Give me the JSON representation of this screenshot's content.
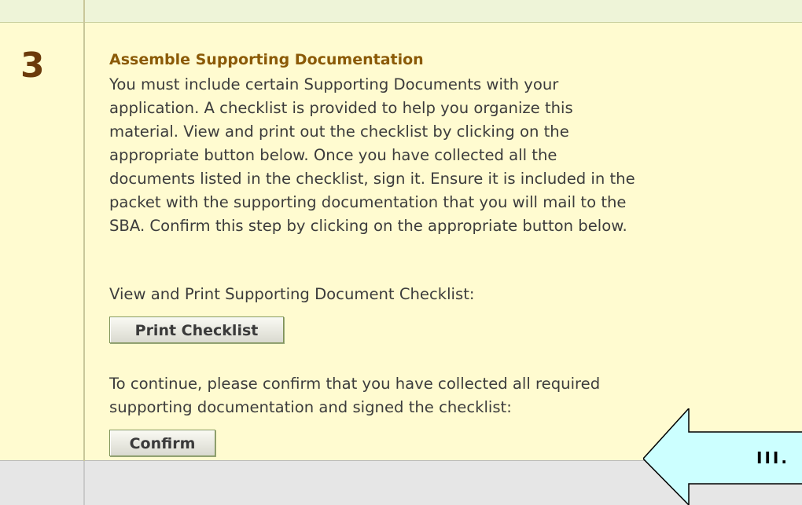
{
  "step": {
    "number": "3",
    "title": "Assemble Supporting Documentation",
    "description_lines": [
      "You must include certain Supporting Documents with your",
      "application. A checklist is provided to help you organize this",
      "material. View and print out the checklist by clicking on the",
      "appropriate button below. Once you have collected all the",
      "documents listed in the checklist, sign it. Ensure it is included in the",
      "packet with the supporting documentation that you will mail to the",
      "SBA. Confirm this step by clicking on the appropriate button below."
    ],
    "print_instruction": "View and Print Supporting Document Checklist:",
    "print_button_label": "Print Checklist",
    "confirm_instruction_lines": [
      "To continue, please confirm that you have collected all required",
      "supporting documentation and signed the checklist:"
    ],
    "confirm_button_label": "Confirm"
  },
  "callout": {
    "label": "III.",
    "fill_color": "#ccffff",
    "stroke_color": "#000000"
  },
  "colors": {
    "panel_background": "#fffbd0",
    "title": "#8b5a07",
    "step_number": "#6b3a0b",
    "body_text": "#3c3c3c"
  }
}
